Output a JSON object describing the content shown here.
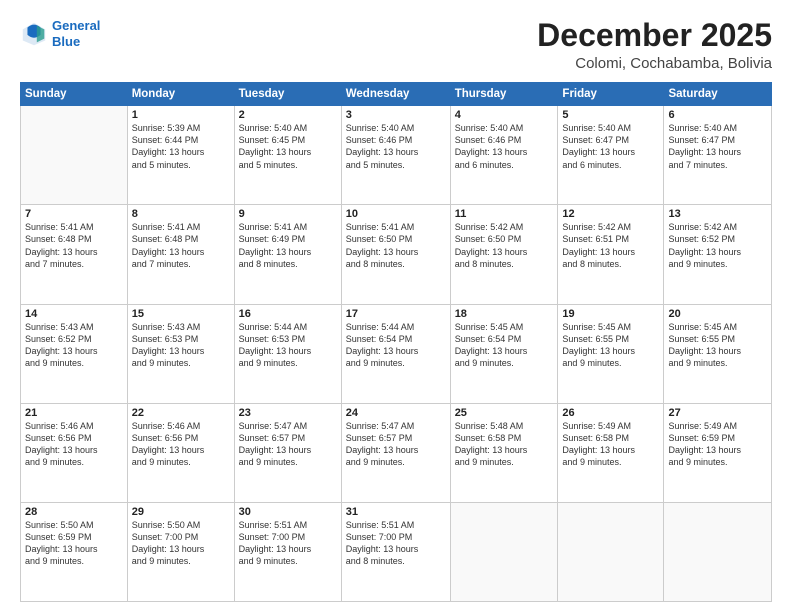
{
  "header": {
    "logo_line1": "General",
    "logo_line2": "Blue",
    "month": "December 2025",
    "location": "Colomi, Cochabamba, Bolivia"
  },
  "weekdays": [
    "Sunday",
    "Monday",
    "Tuesday",
    "Wednesday",
    "Thursday",
    "Friday",
    "Saturday"
  ],
  "weeks": [
    [
      {
        "day": "",
        "lines": []
      },
      {
        "day": "1",
        "lines": [
          "Sunrise: 5:39 AM",
          "Sunset: 6:44 PM",
          "Daylight: 13 hours",
          "and 5 minutes."
        ]
      },
      {
        "day": "2",
        "lines": [
          "Sunrise: 5:40 AM",
          "Sunset: 6:45 PM",
          "Daylight: 13 hours",
          "and 5 minutes."
        ]
      },
      {
        "day": "3",
        "lines": [
          "Sunrise: 5:40 AM",
          "Sunset: 6:46 PM",
          "Daylight: 13 hours",
          "and 5 minutes."
        ]
      },
      {
        "day": "4",
        "lines": [
          "Sunrise: 5:40 AM",
          "Sunset: 6:46 PM",
          "Daylight: 13 hours",
          "and 6 minutes."
        ]
      },
      {
        "day": "5",
        "lines": [
          "Sunrise: 5:40 AM",
          "Sunset: 6:47 PM",
          "Daylight: 13 hours",
          "and 6 minutes."
        ]
      },
      {
        "day": "6",
        "lines": [
          "Sunrise: 5:40 AM",
          "Sunset: 6:47 PM",
          "Daylight: 13 hours",
          "and 7 minutes."
        ]
      }
    ],
    [
      {
        "day": "7",
        "lines": [
          "Sunrise: 5:41 AM",
          "Sunset: 6:48 PM",
          "Daylight: 13 hours",
          "and 7 minutes."
        ]
      },
      {
        "day": "8",
        "lines": [
          "Sunrise: 5:41 AM",
          "Sunset: 6:48 PM",
          "Daylight: 13 hours",
          "and 7 minutes."
        ]
      },
      {
        "day": "9",
        "lines": [
          "Sunrise: 5:41 AM",
          "Sunset: 6:49 PM",
          "Daylight: 13 hours",
          "and 8 minutes."
        ]
      },
      {
        "day": "10",
        "lines": [
          "Sunrise: 5:41 AM",
          "Sunset: 6:50 PM",
          "Daylight: 13 hours",
          "and 8 minutes."
        ]
      },
      {
        "day": "11",
        "lines": [
          "Sunrise: 5:42 AM",
          "Sunset: 6:50 PM",
          "Daylight: 13 hours",
          "and 8 minutes."
        ]
      },
      {
        "day": "12",
        "lines": [
          "Sunrise: 5:42 AM",
          "Sunset: 6:51 PM",
          "Daylight: 13 hours",
          "and 8 minutes."
        ]
      },
      {
        "day": "13",
        "lines": [
          "Sunrise: 5:42 AM",
          "Sunset: 6:52 PM",
          "Daylight: 13 hours",
          "and 9 minutes."
        ]
      }
    ],
    [
      {
        "day": "14",
        "lines": [
          "Sunrise: 5:43 AM",
          "Sunset: 6:52 PM",
          "Daylight: 13 hours",
          "and 9 minutes."
        ]
      },
      {
        "day": "15",
        "lines": [
          "Sunrise: 5:43 AM",
          "Sunset: 6:53 PM",
          "Daylight: 13 hours",
          "and 9 minutes."
        ]
      },
      {
        "day": "16",
        "lines": [
          "Sunrise: 5:44 AM",
          "Sunset: 6:53 PM",
          "Daylight: 13 hours",
          "and 9 minutes."
        ]
      },
      {
        "day": "17",
        "lines": [
          "Sunrise: 5:44 AM",
          "Sunset: 6:54 PM",
          "Daylight: 13 hours",
          "and 9 minutes."
        ]
      },
      {
        "day": "18",
        "lines": [
          "Sunrise: 5:45 AM",
          "Sunset: 6:54 PM",
          "Daylight: 13 hours",
          "and 9 minutes."
        ]
      },
      {
        "day": "19",
        "lines": [
          "Sunrise: 5:45 AM",
          "Sunset: 6:55 PM",
          "Daylight: 13 hours",
          "and 9 minutes."
        ]
      },
      {
        "day": "20",
        "lines": [
          "Sunrise: 5:45 AM",
          "Sunset: 6:55 PM",
          "Daylight: 13 hours",
          "and 9 minutes."
        ]
      }
    ],
    [
      {
        "day": "21",
        "lines": [
          "Sunrise: 5:46 AM",
          "Sunset: 6:56 PM",
          "Daylight: 13 hours",
          "and 9 minutes."
        ]
      },
      {
        "day": "22",
        "lines": [
          "Sunrise: 5:46 AM",
          "Sunset: 6:56 PM",
          "Daylight: 13 hours",
          "and 9 minutes."
        ]
      },
      {
        "day": "23",
        "lines": [
          "Sunrise: 5:47 AM",
          "Sunset: 6:57 PM",
          "Daylight: 13 hours",
          "and 9 minutes."
        ]
      },
      {
        "day": "24",
        "lines": [
          "Sunrise: 5:47 AM",
          "Sunset: 6:57 PM",
          "Daylight: 13 hours",
          "and 9 minutes."
        ]
      },
      {
        "day": "25",
        "lines": [
          "Sunrise: 5:48 AM",
          "Sunset: 6:58 PM",
          "Daylight: 13 hours",
          "and 9 minutes."
        ]
      },
      {
        "day": "26",
        "lines": [
          "Sunrise: 5:49 AM",
          "Sunset: 6:58 PM",
          "Daylight: 13 hours",
          "and 9 minutes."
        ]
      },
      {
        "day": "27",
        "lines": [
          "Sunrise: 5:49 AM",
          "Sunset: 6:59 PM",
          "Daylight: 13 hours",
          "and 9 minutes."
        ]
      }
    ],
    [
      {
        "day": "28",
        "lines": [
          "Sunrise: 5:50 AM",
          "Sunset: 6:59 PM",
          "Daylight: 13 hours",
          "and 9 minutes."
        ]
      },
      {
        "day": "29",
        "lines": [
          "Sunrise: 5:50 AM",
          "Sunset: 7:00 PM",
          "Daylight: 13 hours",
          "and 9 minutes."
        ]
      },
      {
        "day": "30",
        "lines": [
          "Sunrise: 5:51 AM",
          "Sunset: 7:00 PM",
          "Daylight: 13 hours",
          "and 9 minutes."
        ]
      },
      {
        "day": "31",
        "lines": [
          "Sunrise: 5:51 AM",
          "Sunset: 7:00 PM",
          "Daylight: 13 hours",
          "and 8 minutes."
        ]
      },
      {
        "day": "",
        "lines": []
      },
      {
        "day": "",
        "lines": []
      },
      {
        "day": "",
        "lines": []
      }
    ]
  ]
}
